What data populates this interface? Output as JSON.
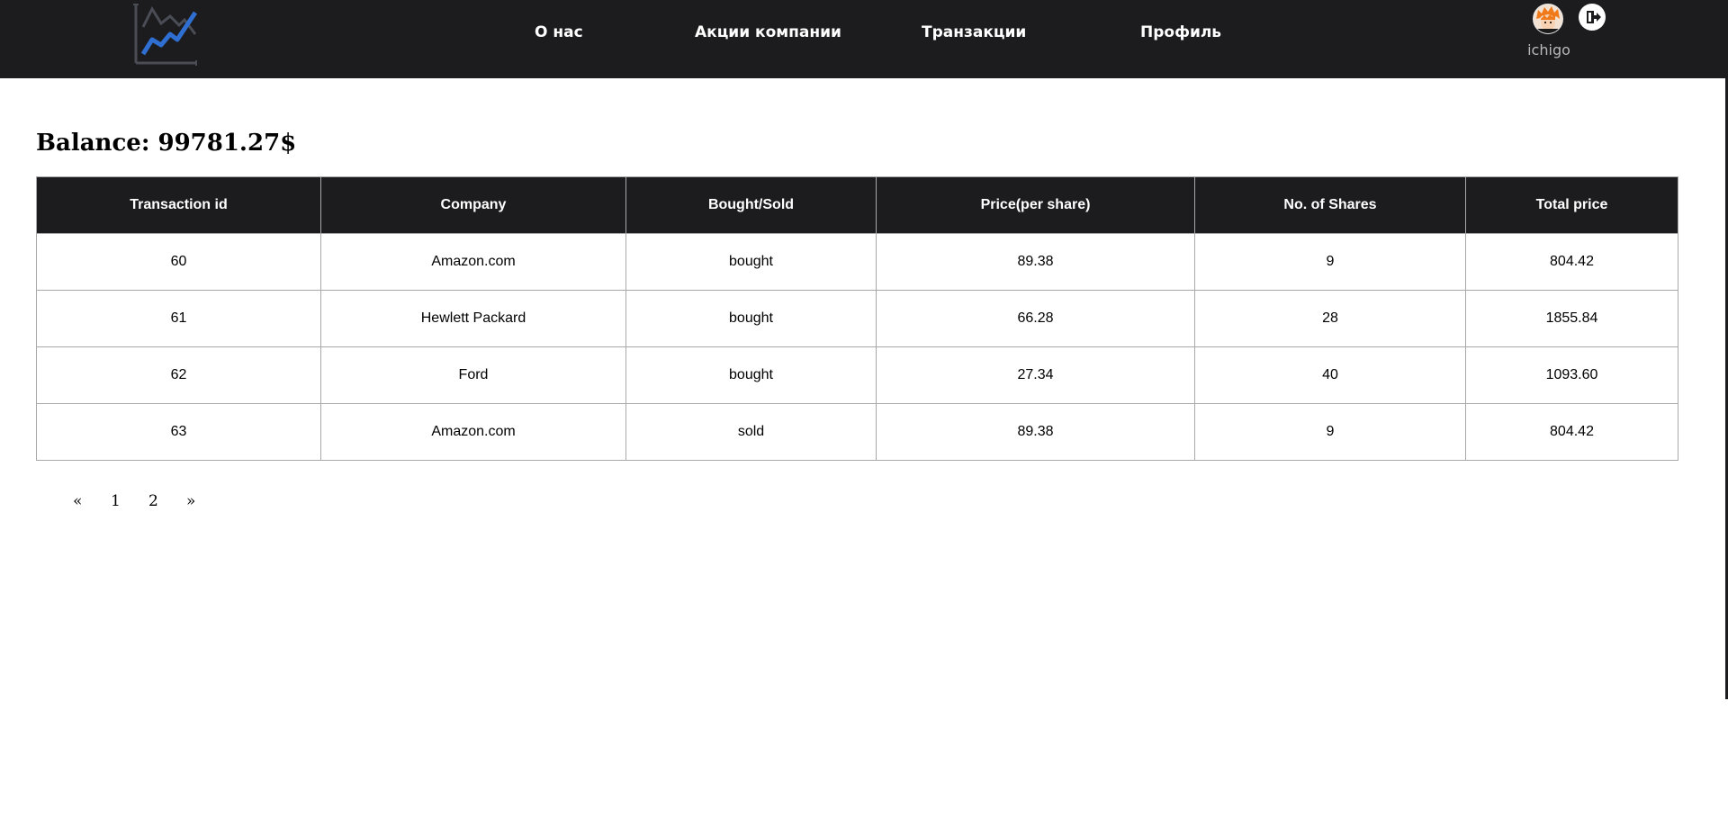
{
  "nav": {
    "links": [
      "О нас",
      "Акции компании",
      "Транзакции",
      "Профиль"
    ],
    "username": "ichigo",
    "logo_icon": "stock-chart-logo-icon",
    "avatar_icon": "user-avatar-icon",
    "logout_icon": "logout-icon"
  },
  "balance": "Balance: 99781.27$",
  "table": {
    "headers": [
      "Transaction id",
      "Company",
      "Bought/Sold",
      "Price(per share)",
      "No. of Shares",
      "Total price"
    ],
    "rows": [
      [
        "60",
        "Amazon.com",
        "bought",
        "89.38",
        "9",
        "804.42"
      ],
      [
        "61",
        "Hewlett Packard",
        "bought",
        "66.28",
        "28",
        "1855.84"
      ],
      [
        "62",
        "Ford",
        "bought",
        "27.34",
        "40",
        "1093.60"
      ],
      [
        "63",
        "Amazon.com",
        "sold",
        "89.38",
        "9",
        "804.42"
      ]
    ]
  },
  "pagination": {
    "prev": "«",
    "pages": [
      "1",
      "2"
    ],
    "next": "»"
  },
  "colors": {
    "navbar_bg": "#1c1c1e",
    "logo_line": "#2e6fd1",
    "table_header_bg": "#1c1c1e"
  }
}
